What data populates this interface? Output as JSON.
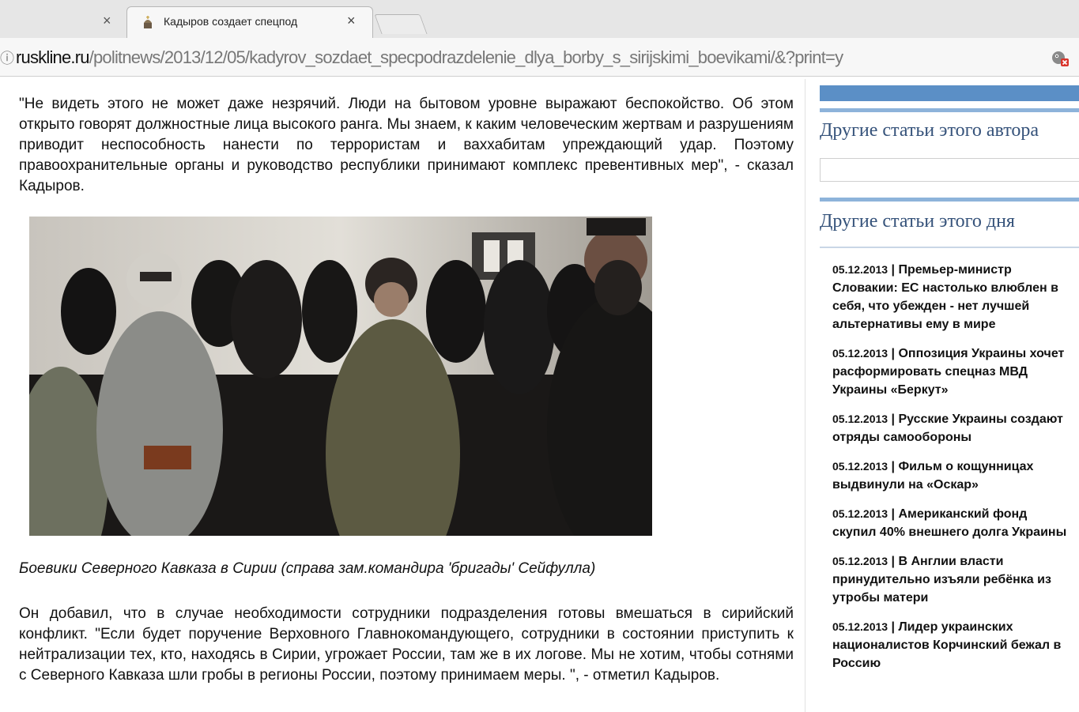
{
  "browser": {
    "prev_tab_close": "×",
    "tab_title": "Кадыров создает спецпод",
    "tab_close": "×",
    "url_scheme_icon": "ⓘ",
    "url_host": "ruskline.ru",
    "url_path": "/politnews/2013/12/05/kadyrov_sozdaet_specpodrazdelenie_dlya_borby_s_sirijskimi_boevikami/&?print=y"
  },
  "article": {
    "paragraph1": "\"Не видеть этого не может даже незрячий. Люди на бытовом уровне выражают беспокойство. Об этом открыто говорят должностные лица высокого ранга. Мы знаем, к каким человеческим жертвам и разрушениям приводит неспособность нанести по террористам и ваххабитам упреждающий удар. Поэтому правоохранительные органы и руководство республики принимают комплекс превентивных мер\", - сказал Кадыров.",
    "caption": "Боевики Северного Кавказа в Сирии (справа зам.командира 'бригады' Сейфулла)",
    "paragraph2": "Он добавил, что в случае необходимости сотрудники подразделения готовы вмешаться в сирийский конфликт. \"Если будет поручение Верховного Главнокомандующего, сотрудники в состоянии приступить к нейтрализации тех, кто, находясь в Сирии, угрожает России, там же в их логове. Мы не хотим, чтобы сотнями с Северного Кавказа шли гробы в регионы России, поэтому принимаем меры. \", - отметил Кадыров."
  },
  "sidebar": {
    "author_heading": "Другие статьи этого автора",
    "day_heading": "Другие статьи этого дня",
    "news": [
      {
        "date": "05.12.2013",
        "title": "Премьер-министр Словакии: ЕС настолько влюблен в себя, что убежден - нет лучшей альтернативы ему в мире"
      },
      {
        "date": "05.12.2013",
        "title": "Оппозиция Украины хочет расформировать спецназ МВД Украины «Беркут»"
      },
      {
        "date": "05.12.2013",
        "title": "Русские Украины создают отряды самообороны"
      },
      {
        "date": "05.12.2013",
        "title": "Фильм о кощунницах выдвинули на «Оскар»"
      },
      {
        "date": "05.12.2013",
        "title": "Американский фонд скупил 40% внешнего долга Украины"
      },
      {
        "date": "05.12.2013",
        "title": "В Англии власти принудительно изъяли ребёнка из утробы матери"
      },
      {
        "date": "05.12.2013",
        "title": "Лидер украинских националистов Корчинский бежал в Россию"
      }
    ]
  },
  "colors": {
    "sidebar_heading": "#35527a",
    "sidebar_bar": "#5b8fc6",
    "sidebar_bar_light": "#8db3da"
  },
  "icons": {
    "favicon": "church-dome-icon",
    "extension": "chameleon-extension-icon"
  }
}
